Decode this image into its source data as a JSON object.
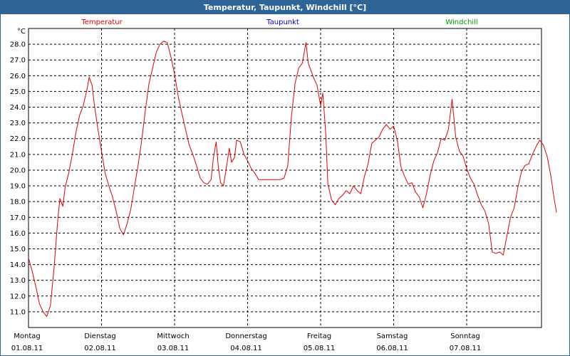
{
  "window": {
    "title": "Temperatur, Taupunkt, Windchill [°C]"
  },
  "colors": {
    "titlebar": "#2f6497",
    "temperatur": "#e00000",
    "taupunkt": "#0000c0",
    "windchill": "#00a000",
    "grid": "#000000"
  },
  "chart_data": {
    "type": "line",
    "title": "Temperatur, Taupunkt, Windchill [°C]",
    "ylabel": "°C",
    "ylim": [
      10,
      29
    ],
    "yticks": [
      "11.0",
      "12.0",
      "13.0",
      "14.0",
      "15.0",
      "16.0",
      "17.0",
      "18.0",
      "19.0",
      "20.0",
      "21.0",
      "22.0",
      "23.0",
      "24.0",
      "25.0",
      "26.0",
      "27.0",
      "28.0"
    ],
    "xlim": [
      0,
      7
    ],
    "x_unit": "days since Montag 01.08.11",
    "xticks": [
      {
        "day": "Montag",
        "date": "01.08.11"
      },
      {
        "day": "Dienstag",
        "date": "02.08.11"
      },
      {
        "day": "Mittwoch",
        "date": "03.08.11"
      },
      {
        "day": "Donnerstag",
        "date": "04.08.11"
      },
      {
        "day": "Freitag",
        "date": "05.08.11"
      },
      {
        "day": "Samstag",
        "date": "06.08.11"
      },
      {
        "day": "Sonntag",
        "date": "07.08.11"
      }
    ],
    "legend": [
      "Temperatur",
      "Taupunkt",
      "Windchill"
    ],
    "grid": true,
    "series": [
      {
        "name": "Temperatur",
        "color": "#e00000",
        "points": [
          [
            0.0,
            14.4
          ],
          [
            0.05,
            13.6
          ],
          [
            0.1,
            12.6
          ],
          [
            0.15,
            11.5
          ],
          [
            0.2,
            11.0
          ],
          [
            0.25,
            10.7
          ],
          [
            0.3,
            11.4
          ],
          [
            0.35,
            13.8
          ],
          [
            0.4,
            16.8
          ],
          [
            0.43,
            18.2
          ],
          [
            0.47,
            17.7
          ],
          [
            0.5,
            18.9
          ],
          [
            0.55,
            19.8
          ],
          [
            0.6,
            21.0
          ],
          [
            0.65,
            22.4
          ],
          [
            0.7,
            23.5
          ],
          [
            0.75,
            24.1
          ],
          [
            0.8,
            25.1
          ],
          [
            0.83,
            25.9
          ],
          [
            0.87,
            25.4
          ],
          [
            0.9,
            24.2
          ],
          [
            0.95,
            22.6
          ],
          [
            1.0,
            21.2
          ],
          [
            1.05,
            19.8
          ],
          [
            1.1,
            19.0
          ],
          [
            1.15,
            18.3
          ],
          [
            1.2,
            17.4
          ],
          [
            1.25,
            16.3
          ],
          [
            1.3,
            15.9
          ],
          [
            1.35,
            16.6
          ],
          [
            1.4,
            17.5
          ],
          [
            1.45,
            18.9
          ],
          [
            1.5,
            20.3
          ],
          [
            1.55,
            21.9
          ],
          [
            1.6,
            23.8
          ],
          [
            1.65,
            25.5
          ],
          [
            1.7,
            26.5
          ],
          [
            1.75,
            27.5
          ],
          [
            1.8,
            28.0
          ],
          [
            1.85,
            28.2
          ],
          [
            1.9,
            28.1
          ],
          [
            1.95,
            27.2
          ],
          [
            2.0,
            26.1
          ],
          [
            2.05,
            24.7
          ],
          [
            2.1,
            23.6
          ],
          [
            2.15,
            22.6
          ],
          [
            2.2,
            21.6
          ],
          [
            2.25,
            21.0
          ],
          [
            2.3,
            20.3
          ],
          [
            2.35,
            19.5
          ],
          [
            2.4,
            19.2
          ],
          [
            2.45,
            19.1
          ],
          [
            2.5,
            19.4
          ],
          [
            2.53,
            20.7
          ],
          [
            2.57,
            21.8
          ],
          [
            2.6,
            20.2
          ],
          [
            2.63,
            19.2
          ],
          [
            2.67,
            19.0
          ],
          [
            2.7,
            19.9
          ],
          [
            2.75,
            21.4
          ],
          [
            2.78,
            20.5
          ],
          [
            2.82,
            20.8
          ],
          [
            2.85,
            21.9
          ],
          [
            2.9,
            21.8
          ],
          [
            2.95,
            21.0
          ],
          [
            3.0,
            20.6
          ],
          [
            3.05,
            20.1
          ],
          [
            3.1,
            19.8
          ],
          [
            3.15,
            19.4
          ],
          [
            3.2,
            19.4
          ],
          [
            3.3,
            19.4
          ],
          [
            3.4,
            19.4
          ],
          [
            3.45,
            19.4
          ],
          [
            3.5,
            19.5
          ],
          [
            3.55,
            20.3
          ],
          [
            3.6,
            23.4
          ],
          [
            3.65,
            25.5
          ],
          [
            3.7,
            26.5
          ],
          [
            3.75,
            26.8
          ],
          [
            3.78,
            27.6
          ],
          [
            3.8,
            28.1
          ],
          [
            3.83,
            26.8
          ],
          [
            3.87,
            26.3
          ],
          [
            3.9,
            25.9
          ],
          [
            3.95,
            25.4
          ],
          [
            4.0,
            24.1
          ],
          [
            4.03,
            24.9
          ],
          [
            4.07,
            22.3
          ],
          [
            4.1,
            19.1
          ],
          [
            4.15,
            18.1
          ],
          [
            4.2,
            17.8
          ],
          [
            4.25,
            18.2
          ],
          [
            4.3,
            18.4
          ],
          [
            4.35,
            18.7
          ],
          [
            4.4,
            18.5
          ],
          [
            4.45,
            19.0
          ],
          [
            4.5,
            18.7
          ],
          [
            4.55,
            18.5
          ],
          [
            4.6,
            19.6
          ],
          [
            4.65,
            20.4
          ],
          [
            4.7,
            21.7
          ],
          [
            4.75,
            21.9
          ],
          [
            4.8,
            22.1
          ],
          [
            4.85,
            22.6
          ],
          [
            4.9,
            22.9
          ],
          [
            4.95,
            22.6
          ],
          [
            5.0,
            22.8
          ],
          [
            5.05,
            21.9
          ],
          [
            5.1,
            20.2
          ],
          [
            5.15,
            19.6
          ],
          [
            5.2,
            19.1
          ],
          [
            5.25,
            19.2
          ],
          [
            5.3,
            18.6
          ],
          [
            5.35,
            18.3
          ],
          [
            5.4,
            17.6
          ],
          [
            5.45,
            18.5
          ],
          [
            5.5,
            19.7
          ],
          [
            5.55,
            20.6
          ],
          [
            5.6,
            21.1
          ],
          [
            5.65,
            22.0
          ],
          [
            5.7,
            21.9
          ],
          [
            5.75,
            22.6
          ],
          [
            5.8,
            24.5
          ],
          [
            5.85,
            22.1
          ],
          [
            5.9,
            21.2
          ],
          [
            5.95,
            20.9
          ],
          [
            6.0,
            20.1
          ],
          [
            6.05,
            19.5
          ],
          [
            6.1,
            19.1
          ],
          [
            6.15,
            18.4
          ],
          [
            6.2,
            17.8
          ],
          [
            6.25,
            17.4
          ],
          [
            6.3,
            16.6
          ],
          [
            6.35,
            14.8
          ],
          [
            6.4,
            14.7
          ],
          [
            6.45,
            14.8
          ],
          [
            6.5,
            14.6
          ],
          [
            6.55,
            15.8
          ],
          [
            6.6,
            17.0
          ],
          [
            6.65,
            17.6
          ],
          [
            6.7,
            18.9
          ],
          [
            6.75,
            19.9
          ],
          [
            6.8,
            20.3
          ],
          [
            6.85,
            20.4
          ],
          [
            6.9,
            21.0
          ],
          [
            6.95,
            21.5
          ],
          [
            7.0,
            21.9
          ],
          [
            7.05,
            21.6
          ],
          [
            7.1,
            20.9
          ],
          [
            7.15,
            19.7
          ],
          [
            7.2,
            18.1
          ],
          [
            7.23,
            17.3
          ]
        ]
      }
    ]
  }
}
